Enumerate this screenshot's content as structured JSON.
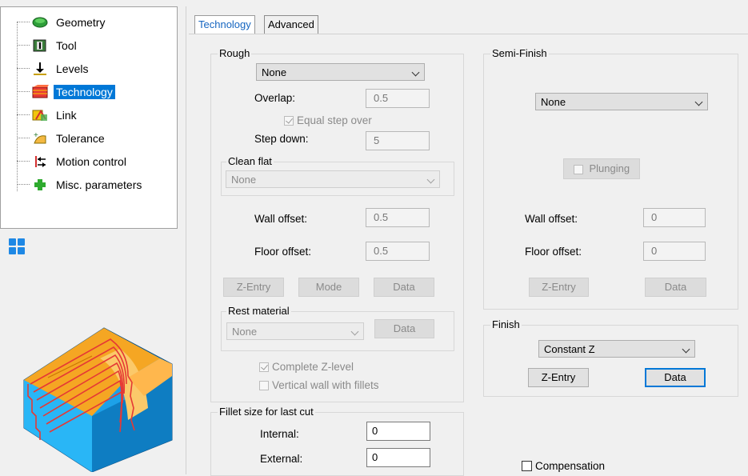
{
  "tree": {
    "items": [
      {
        "label": "Geometry",
        "icon": "geometry-icon"
      },
      {
        "label": "Tool",
        "icon": "tool-icon"
      },
      {
        "label": "Levels",
        "icon": "levels-icon"
      },
      {
        "label": "Technology",
        "icon": "technology-icon",
        "selected": true
      },
      {
        "label": "Link",
        "icon": "link-icon"
      },
      {
        "label": "Tolerance",
        "icon": "tolerance-icon"
      },
      {
        "label": "Motion control",
        "icon": "motion-control-icon"
      },
      {
        "label": "Misc. parameters",
        "icon": "misc-parameters-icon"
      }
    ]
  },
  "tabs": {
    "technology": "Technology",
    "advanced": "Advanced"
  },
  "rough": {
    "title": "Rough",
    "strategy": "None",
    "overlap_label": "Overlap:",
    "overlap": "0.5",
    "equal_step_over": "Equal step over",
    "step_down_label": "Step down:",
    "step_down": "5",
    "clean_flat": {
      "title": "Clean flat",
      "value": "None"
    },
    "wall_offset_label": "Wall offset:",
    "wall_offset": "0.5",
    "floor_offset_label": "Floor offset:",
    "floor_offset": "0.5",
    "z_entry": "Z-Entry",
    "mode": "Mode",
    "data": "Data",
    "rest_material": {
      "title": "Rest material",
      "value": "None",
      "data": "Data"
    },
    "complete_z_level": "Complete Z-level",
    "vertical_wall": "Vertical wall with fillets"
  },
  "semi_finish": {
    "title": "Semi-Finish",
    "strategy": "None",
    "plunging": "Plunging",
    "wall_offset_label": "Wall offset:",
    "wall_offset": "0",
    "floor_offset_label": "Floor offset:",
    "floor_offset": "0",
    "z_entry": "Z-Entry",
    "data": "Data"
  },
  "finish": {
    "title": "Finish",
    "strategy": "Constant Z",
    "z_entry": "Z-Entry",
    "data": "Data"
  },
  "fillet": {
    "title": "Fillet size for last cut",
    "internal_label": "Internal:",
    "internal": "0",
    "external_label": "External:",
    "external": "0"
  },
  "compensation": "Compensation",
  "colors": {
    "selection": "#0078d7",
    "focus": "#0078d7",
    "toolpath": "#e53935"
  }
}
